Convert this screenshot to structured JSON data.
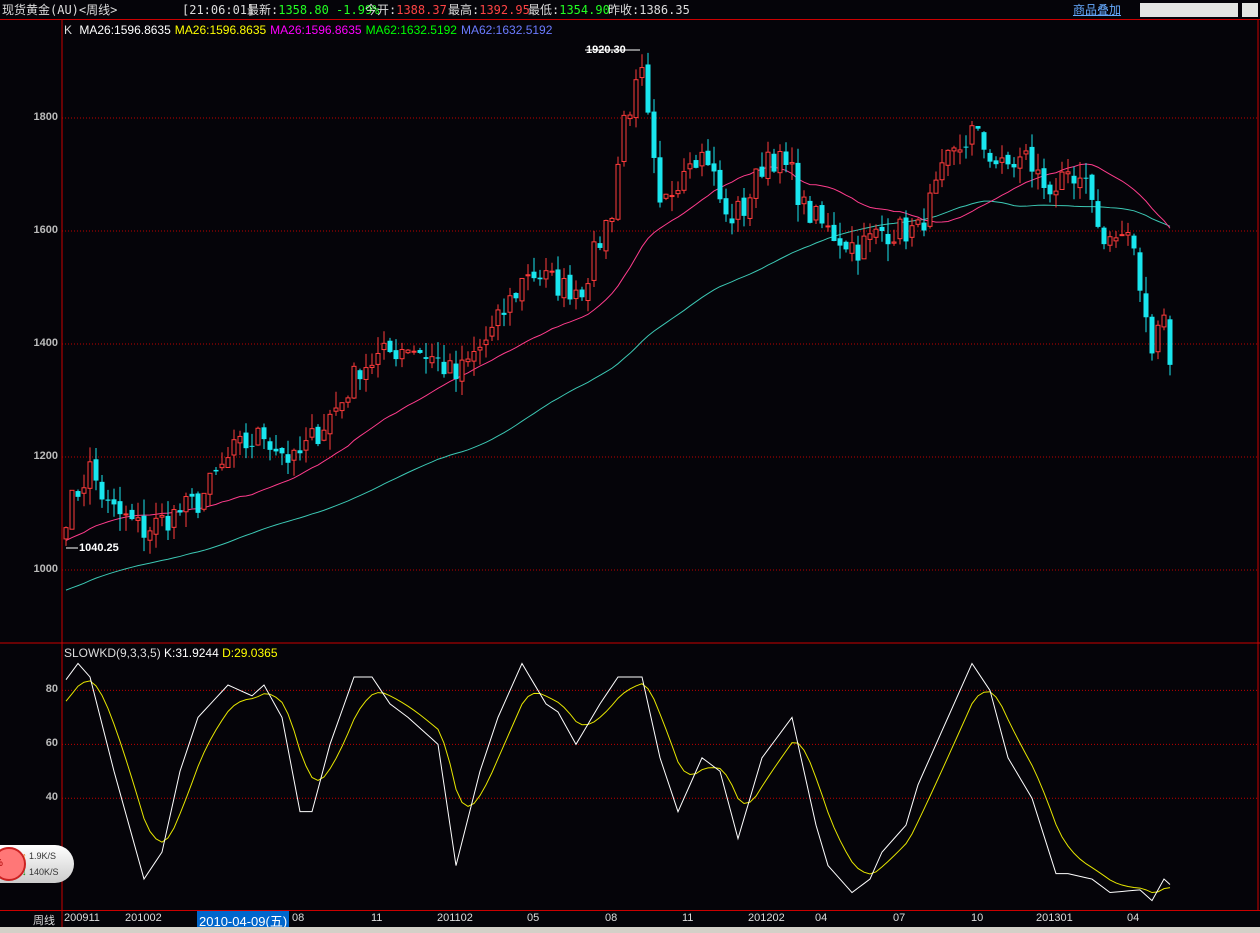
{
  "header": {
    "title": "现货黄金(AU)<周线>",
    "time": "[21:06:01]",
    "latest_label": "最新:",
    "latest": "1358.80",
    "change": "-1.99%",
    "open_label": "今开:",
    "open": "1388.37",
    "high_label": "最高:",
    "high": "1392.95",
    "low_label": "最低:",
    "low": "1354.90",
    "prev_label": "昨收:",
    "prev": "1386.35",
    "overlay_link": "商品叠加"
  },
  "legend": {
    "k": "K",
    "items": [
      {
        "text": "MA26:1596.8635",
        "color": "#ffffff"
      },
      {
        "text": "MA26:1596.8635",
        "color": "#ffff00"
      },
      {
        "text": "MA26:1596.8635",
        "color": "#ff00ff"
      },
      {
        "text": "MA62:1632.5192",
        "color": "#00ff00"
      },
      {
        "text": "MA62:1632.5192",
        "color": "#6b7bff"
      }
    ]
  },
  "kd_legend": {
    "name": "SLOWKD(9,3,3,5)",
    "k": "K:31.9244",
    "d": "D:29.0365"
  },
  "network": {
    "percent": "%",
    "up": "1.9K/S",
    "down": "140K/S"
  },
  "xaxis": {
    "period": "周线",
    "labels": [
      "200911",
      "201002",
      "08",
      "11",
      "201102",
      "05",
      "08",
      "11",
      "201202",
      "04",
      "07",
      "10",
      "201301",
      "04"
    ],
    "cursor_date": "2010-04-09(五)"
  },
  "colors": {
    "up": "#ff3b3b",
    "down": "#19e6ee",
    "ma26": "#ff3c8c",
    "ma62": "#3cc8b4",
    "k": "#ffffff",
    "d": "#e6e600",
    "grid": "#c00000"
  },
  "chart_data": [
    {
      "type": "candlestick",
      "title": "现货黄金(AU) 周线",
      "y_ticks": [
        1800,
        1600,
        1400,
        1200,
        1000
      ],
      "ylim": [
        880,
        1970
      ],
      "max_label": "1920.30",
      "min_label": "1040.25",
      "max": 1920.3,
      "min": 1040.25,
      "weeks": 185,
      "close_anchors": [
        [
          0,
          1100
        ],
        [
          4,
          1180
        ],
        [
          7,
          1110
        ],
        [
          13,
          1070
        ],
        [
          22,
          1120
        ],
        [
          28,
          1210
        ],
        [
          33,
          1240
        ],
        [
          38,
          1190
        ],
        [
          46,
          1300
        ],
        [
          49,
          1360
        ],
        [
          53,
          1380
        ],
        [
          57,
          1400
        ],
        [
          62,
          1370
        ],
        [
          65,
          1340
        ],
        [
          71,
          1420
        ],
        [
          77,
          1530
        ],
        [
          83,
          1500
        ],
        [
          86,
          1500
        ],
        [
          91,
          1640
        ],
        [
          93,
          1800
        ],
        [
          96,
          1870
        ],
        [
          99,
          1630
        ],
        [
          104,
          1740
        ],
        [
          107,
          1730
        ],
        [
          110,
          1620
        ],
        [
          113,
          1640
        ],
        [
          117,
          1740
        ],
        [
          121,
          1700
        ],
        [
          123,
          1640
        ],
        [
          127,
          1600
        ],
        [
          132,
          1570
        ],
        [
          136,
          1600
        ],
        [
          142,
          1600
        ],
        [
          147,
          1720
        ],
        [
          151,
          1775
        ],
        [
          156,
          1710
        ],
        [
          160,
          1730
        ],
        [
          163,
          1680
        ],
        [
          167,
          1680
        ],
        [
          171,
          1670
        ],
        [
          172,
          1600
        ],
        [
          176,
          1580
        ],
        [
          178,
          1570
        ],
        [
          180,
          1450
        ],
        [
          181,
          1400
        ],
        [
          183,
          1450
        ],
        [
          184,
          1360
        ]
      ]
    },
    {
      "type": "line",
      "title": "SLOWKD(9,3,3,5)",
      "y_ticks": [
        80,
        60,
        40
      ],
      "ylim": [
        0,
        95
      ],
      "k_anchors": [
        [
          0,
          84
        ],
        [
          2,
          90
        ],
        [
          4,
          85
        ],
        [
          8,
          50
        ],
        [
          13,
          10
        ],
        [
          16,
          20
        ],
        [
          19,
          50
        ],
        [
          22,
          70
        ],
        [
          27,
          82
        ],
        [
          31,
          78
        ],
        [
          33,
          82
        ],
        [
          36,
          70
        ],
        [
          39,
          35
        ],
        [
          41,
          35
        ],
        [
          44,
          60
        ],
        [
          48,
          85
        ],
        [
          51,
          85
        ],
        [
          54,
          75
        ],
        [
          57,
          70
        ],
        [
          62,
          60
        ],
        [
          65,
          15
        ],
        [
          69,
          50
        ],
        [
          72,
          70
        ],
        [
          76,
          90
        ],
        [
          80,
          75
        ],
        [
          82,
          72
        ],
        [
          85,
          60
        ],
        [
          89,
          75
        ],
        [
          92,
          85
        ],
        [
          96,
          85
        ],
        [
          99,
          55
        ],
        [
          102,
          35
        ],
        [
          106,
          55
        ],
        [
          109,
          50
        ],
        [
          112,
          25
        ],
        [
          116,
          55
        ],
        [
          121,
          70
        ],
        [
          122,
          60
        ],
        [
          125,
          30
        ],
        [
          127,
          15
        ],
        [
          131,
          5
        ],
        [
          134,
          10
        ],
        [
          136,
          20
        ],
        [
          140,
          30
        ],
        [
          142,
          45
        ],
        [
          146,
          65
        ],
        [
          151,
          90
        ],
        [
          154,
          80
        ],
        [
          157,
          55
        ],
        [
          161,
          40
        ],
        [
          165,
          12
        ],
        [
          167,
          12
        ],
        [
          171,
          10
        ],
        [
          174,
          5
        ],
        [
          179,
          6
        ],
        [
          181,
          2
        ],
        [
          183,
          10
        ],
        [
          184,
          8
        ]
      ]
    }
  ]
}
